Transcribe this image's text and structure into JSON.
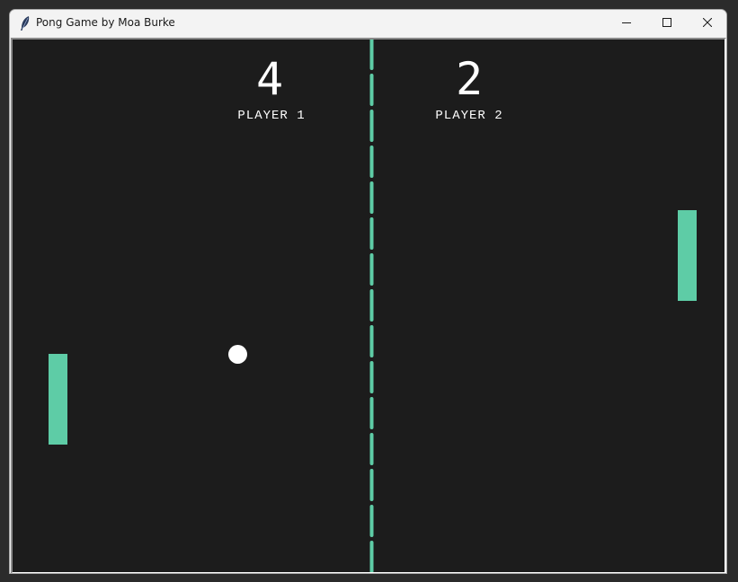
{
  "window": {
    "title": "Pong Game by Moa Burke",
    "icon": "feather-icon",
    "controls": [
      "minimize-icon",
      "maximize-icon",
      "close-icon"
    ]
  },
  "game": {
    "player1": {
      "score": "4",
      "label": "PLAYER 1"
    },
    "player2": {
      "score": "2",
      "label": "PLAYER 2"
    },
    "colors": {
      "background": "#1c1c1c",
      "paddle": "#5ecca6",
      "ball": "#ffffff",
      "net": "#5ecca6",
      "text": "#ffffff"
    }
  }
}
